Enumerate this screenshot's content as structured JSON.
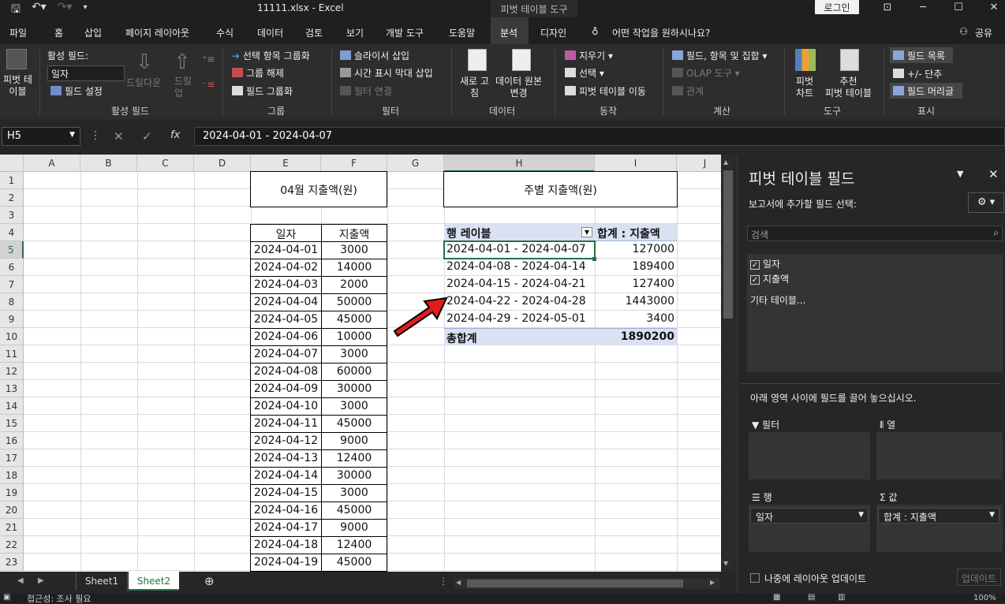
{
  "titlebar": {
    "filename": "11111.xlsx  -  Excel",
    "context_tab": "피벗 테이블 도구",
    "login": "로그인"
  },
  "tabs": [
    "파일",
    "홈",
    "삽입",
    "페이지 레이아웃",
    "수식",
    "데이터",
    "검토",
    "보기",
    "개발 도구",
    "도움말",
    "분석",
    "디자인"
  ],
  "tab_active": "분석",
  "tell_me": "어떤 작업을 원하시나요?",
  "share": "공유",
  "ribbon": {
    "pivot_table_btn": "피벗 테\n이블",
    "active_field_label": "활성 필드:",
    "active_field_value": "일자",
    "field_settings": "필드 설정",
    "drill_down": "드릴다운",
    "drill_up": "드릴\n업",
    "group_active_field": "활성 필드",
    "group_selection": "선택 항목 그룹화",
    "ungroup": "그룹 해제",
    "group_field": "필드 그룹화",
    "group_group": "그룹",
    "insert_slicer": "슬라이서 삽입",
    "insert_timeline": "시간 표시 막대 삽입",
    "filter_connections": "필터 연결",
    "group_filter": "필터",
    "refresh": "새로 고\n침",
    "change_source": "데이터 원본\n변경",
    "group_data": "데이터",
    "clear": "지우기",
    "select": "선택",
    "move_pivot": "피벗 테이블 이동",
    "group_actions": "동작",
    "fields_items_sets": "필드, 항목 및 집합",
    "olap_tools": "OLAP 도구",
    "relationships": "관계",
    "group_calc": "계산",
    "pivot_chart": "피벗\n차트",
    "recommended": "추천\n피벗 테이블",
    "group_tools": "도구",
    "field_list": "필드 목록",
    "plus_minus": "+/- 단추",
    "field_headers": "필드 머리글",
    "group_show": "표시"
  },
  "formula": {
    "namebox": "H5",
    "value": "2024-04-01 - 2024-04-07"
  },
  "columns": [
    "A",
    "B",
    "C",
    "D",
    "E",
    "F",
    "G",
    "H",
    "I",
    "J"
  ],
  "rows": [
    "1",
    "2",
    "3",
    "4",
    "5",
    "6",
    "7",
    "8",
    "9",
    "10",
    "11",
    "12",
    "13",
    "14",
    "15",
    "16",
    "17",
    "18",
    "19",
    "20",
    "21",
    "22",
    "23"
  ],
  "sheet": {
    "title_left": "04월 지출액(원)",
    "title_right": "주별 지출액(원)",
    "hdr_date": "일자",
    "hdr_amount": "지출액",
    "data": [
      [
        "2024-04-01",
        "3000"
      ],
      [
        "2024-04-02",
        "14000"
      ],
      [
        "2024-04-03",
        "2000"
      ],
      [
        "2024-04-04",
        "50000"
      ],
      [
        "2024-04-05",
        "45000"
      ],
      [
        "2024-04-06",
        "10000"
      ],
      [
        "2024-04-07",
        "3000"
      ],
      [
        "2024-04-08",
        "60000"
      ],
      [
        "2024-04-09",
        "30000"
      ],
      [
        "2024-04-10",
        "3000"
      ],
      [
        "2024-04-11",
        "45000"
      ],
      [
        "2024-04-12",
        "9000"
      ],
      [
        "2024-04-13",
        "12400"
      ],
      [
        "2024-04-14",
        "30000"
      ],
      [
        "2024-04-15",
        "3000"
      ],
      [
        "2024-04-16",
        "45000"
      ],
      [
        "2024-04-17",
        "9000"
      ],
      [
        "2024-04-18",
        "12400"
      ],
      [
        "2024-04-19",
        "45000"
      ]
    ],
    "pivot_row_label": "행 레이블",
    "pivot_sum_label": "합계 : 지출액",
    "pivot_rows": [
      [
        "2024-04-01 - 2024-04-07",
        "127000"
      ],
      [
        "2024-04-08 - 2024-04-14",
        "189400"
      ],
      [
        "2024-04-15 - 2024-04-21",
        "127400"
      ],
      [
        "2024-04-22 - 2024-04-28",
        "1443000"
      ],
      [
        "2024-04-29 - 2024-05-01",
        "3400"
      ]
    ],
    "pivot_total_label": "총합계",
    "pivot_total": "1890200"
  },
  "sheet_tabs": [
    "Sheet1",
    "Sheet2"
  ],
  "active_sheet": "Sheet2",
  "pane": {
    "title": "피벗 테이블 필드",
    "subtitle": "보고서에 추가할 필드 선택:",
    "search_placeholder": "검색",
    "fields": [
      "일자",
      "지출액"
    ],
    "more_tables": "기타 테이블...",
    "drag_hint": "아래 영역 사이에 필드를 끌어 놓으십시오.",
    "area_filter": "필터",
    "area_columns": "열",
    "area_rows": "행",
    "area_values": "값",
    "rows_value": "일자",
    "values_value": "합계 : 지출액",
    "defer_update": "나중에 레이아웃 업데이트",
    "update_btn": "업데이트"
  },
  "status": {
    "text": "접근성: 조사 필요",
    "zoom": "100%"
  }
}
